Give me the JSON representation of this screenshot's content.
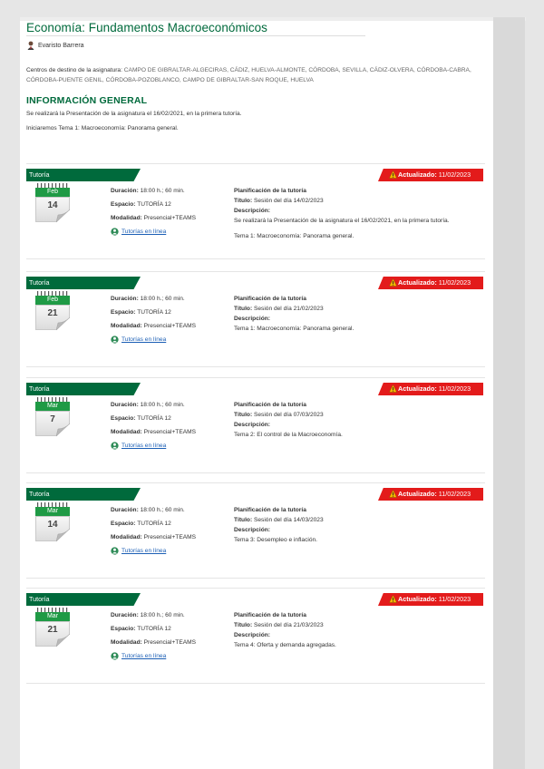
{
  "course": {
    "title": "Economía: Fundamentos Macroeconómicos"
  },
  "teacher": {
    "name": "Evaristo Barrera"
  },
  "centers": {
    "label": "Centros de destino de la asignatura:",
    "line1": "CAMPO DE GIBRALTAR-ALGECIRAS, CÁDIZ, HUELVA-ALMONTE, CÓRDOBA, SEVILLA, CÁDIZ-OLVERA, CÓRDOBA-CABRA,",
    "line2": "CÓRDOBA-PUENTE GENIL, CÓRDOBA-POZOBLANCO, CAMPO DE GIBRALTAR-SAN ROQUE, HUELVA"
  },
  "general": {
    "heading": "INFORMACIÓN GENERAL",
    "line1": "Se realizará la Presentación de la asignatura el 16/02/2021, en la primera tutoría.",
    "line2": "Iniciaremos Tema 1: Macroeconomía: Panorama general."
  },
  "labels": {
    "tutoria": "Tutoría",
    "actualizado": "Actualizado:",
    "duracion": "Duración:",
    "espacio": "Espacio:",
    "modalidad": "Modalidad:",
    "online_link": "Tutorías en línea",
    "planificacion": "Planificación de la tutoría",
    "titulo": "Título:",
    "descripcion": "Descripción:"
  },
  "sessions": [
    {
      "month": "Feb",
      "day": "14",
      "updated": "11/02/2023",
      "duration": "18:00 h.; 60 min.",
      "space": "TUTORÍA 12",
      "mode": "Presencial+TEAMS",
      "title": "Sesión del día 14/02/2023",
      "desc1": "Se realizará la Presentación de la asignatura el 16/02/2021, en la primera tutoría.",
      "desc2": "Tema 1: Macroeconomía: Panorama general."
    },
    {
      "month": "Feb",
      "day": "21",
      "updated": "11/02/2023",
      "duration": "18:00 h.; 60 min.",
      "space": "TUTORÍA 12",
      "mode": "Presencial+TEAMS",
      "title": "Sesión del día 21/02/2023",
      "desc1": "Tema 1: Macroeconomía: Panorama general.",
      "desc2": ""
    },
    {
      "month": "Mar",
      "day": "7",
      "updated": "11/02/2023",
      "duration": "18:00 h.; 60 min.",
      "space": "TUTORÍA 12",
      "mode": "Presencial+TEAMS",
      "title": "Sesión del día 07/03/2023",
      "desc1": "Tema 2: El control de la Macroeconomía.",
      "desc2": ""
    },
    {
      "month": "Mar",
      "day": "14",
      "updated": "11/02/2023",
      "duration": "18:00 h.; 60 min.",
      "space": "TUTORÍA 12",
      "mode": "Presencial+TEAMS",
      "title": "Sesión del día 14/03/2023",
      "desc1": "Tema 3: Desempleo e inflación.",
      "desc2": ""
    },
    {
      "month": "Mar",
      "day": "21",
      "updated": "11/02/2023",
      "duration": "18:00 h.; 60 min.",
      "space": "TUTORÍA 12",
      "mode": "Presencial+TEAMS",
      "title": "Sesión del día 21/03/2023",
      "desc1": "Tema 4: Oferta y demanda agregadas.",
      "desc2": ""
    }
  ]
}
